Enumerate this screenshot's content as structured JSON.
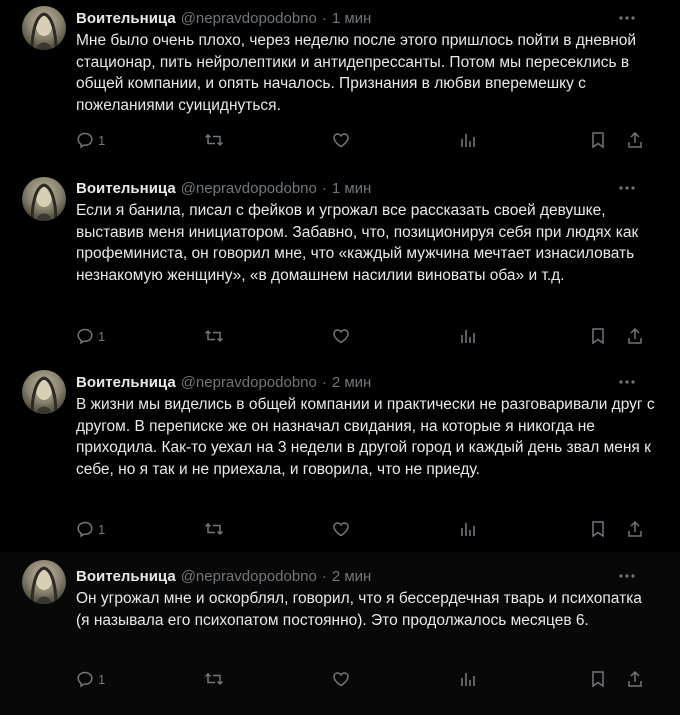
{
  "tweets": [
    {
      "name": "Воительница",
      "handle": "@nepravdopodobno",
      "time": "1 мин",
      "text": "Мне было очень плохо, через неделю после этого пришлось пойти в дневной стационар, пить нейролептики и антидепрессанты. Потом мы пересеклись в общей компании, и опять началось. Признания в любви вперемешку с пожеланиями суициднуться.",
      "replies": "1"
    },
    {
      "name": "Воительница",
      "handle": "@nepravdopodobno",
      "time": "1 мин",
      "text": "Если я банила, писал с фейков и угрожал все рассказать своей девушке, выставив меня инициатором. Забавно, что, позиционируя себя при людях как профеминиста, он говорил мне, что «каждый мужчина мечтает изнасиловать незнакомую женщину», «в домашнем насилии виноваты оба» и т.д.",
      "replies": "1"
    },
    {
      "name": "Воительница",
      "handle": "@nepravdopodobno",
      "time": "2 мин",
      "text": "В жизни мы виделись в общей компании и практически не разговаривали друг с другом. В переписке же он назначал свидания, на которые я никогда не приходила. Как-то уехал на 3 недели в другой город и каждый день звал меня к себе, но я так и не приехала, и говорила, что не приеду.",
      "replies": "1"
    },
    {
      "name": "Воительница",
      "handle": "@nepravdopodobno",
      "time": "2 мин",
      "text": "Он угрожал мне и оскорблял, говорил, что я бессердечная тварь и психопатка (я называла его психопатом постоянно). Это продолжалось месяцев 6.",
      "replies": "1"
    }
  ],
  "colors": {
    "background": "#000000",
    "text": "#e7e9ea",
    "muted": "#71767b"
  },
  "icons": [
    "avatar",
    "more-icon",
    "reply-icon",
    "retweet-icon",
    "like-icon",
    "views-icon",
    "bookmark-icon",
    "share-icon"
  ]
}
